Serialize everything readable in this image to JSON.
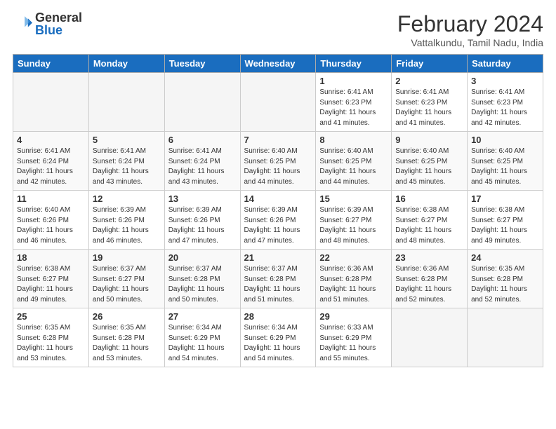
{
  "logo": {
    "general": "General",
    "blue": "Blue"
  },
  "title": "February 2024",
  "location": "Vattalkundu, Tamil Nadu, India",
  "days_of_week": [
    "Sunday",
    "Monday",
    "Tuesday",
    "Wednesday",
    "Thursday",
    "Friday",
    "Saturday"
  ],
  "weeks": [
    [
      {
        "day": "",
        "info": ""
      },
      {
        "day": "",
        "info": ""
      },
      {
        "day": "",
        "info": ""
      },
      {
        "day": "",
        "info": ""
      },
      {
        "day": "1",
        "info": "Sunrise: 6:41 AM\nSunset: 6:23 PM\nDaylight: 11 hours\nand 41 minutes."
      },
      {
        "day": "2",
        "info": "Sunrise: 6:41 AM\nSunset: 6:23 PM\nDaylight: 11 hours\nand 41 minutes."
      },
      {
        "day": "3",
        "info": "Sunrise: 6:41 AM\nSunset: 6:23 PM\nDaylight: 11 hours\nand 42 minutes."
      }
    ],
    [
      {
        "day": "4",
        "info": "Sunrise: 6:41 AM\nSunset: 6:24 PM\nDaylight: 11 hours\nand 42 minutes."
      },
      {
        "day": "5",
        "info": "Sunrise: 6:41 AM\nSunset: 6:24 PM\nDaylight: 11 hours\nand 43 minutes."
      },
      {
        "day": "6",
        "info": "Sunrise: 6:41 AM\nSunset: 6:24 PM\nDaylight: 11 hours\nand 43 minutes."
      },
      {
        "day": "7",
        "info": "Sunrise: 6:40 AM\nSunset: 6:25 PM\nDaylight: 11 hours\nand 44 minutes."
      },
      {
        "day": "8",
        "info": "Sunrise: 6:40 AM\nSunset: 6:25 PM\nDaylight: 11 hours\nand 44 minutes."
      },
      {
        "day": "9",
        "info": "Sunrise: 6:40 AM\nSunset: 6:25 PM\nDaylight: 11 hours\nand 45 minutes."
      },
      {
        "day": "10",
        "info": "Sunrise: 6:40 AM\nSunset: 6:25 PM\nDaylight: 11 hours\nand 45 minutes."
      }
    ],
    [
      {
        "day": "11",
        "info": "Sunrise: 6:40 AM\nSunset: 6:26 PM\nDaylight: 11 hours\nand 46 minutes."
      },
      {
        "day": "12",
        "info": "Sunrise: 6:39 AM\nSunset: 6:26 PM\nDaylight: 11 hours\nand 46 minutes."
      },
      {
        "day": "13",
        "info": "Sunrise: 6:39 AM\nSunset: 6:26 PM\nDaylight: 11 hours\nand 47 minutes."
      },
      {
        "day": "14",
        "info": "Sunrise: 6:39 AM\nSunset: 6:26 PM\nDaylight: 11 hours\nand 47 minutes."
      },
      {
        "day": "15",
        "info": "Sunrise: 6:39 AM\nSunset: 6:27 PM\nDaylight: 11 hours\nand 48 minutes."
      },
      {
        "day": "16",
        "info": "Sunrise: 6:38 AM\nSunset: 6:27 PM\nDaylight: 11 hours\nand 48 minutes."
      },
      {
        "day": "17",
        "info": "Sunrise: 6:38 AM\nSunset: 6:27 PM\nDaylight: 11 hours\nand 49 minutes."
      }
    ],
    [
      {
        "day": "18",
        "info": "Sunrise: 6:38 AM\nSunset: 6:27 PM\nDaylight: 11 hours\nand 49 minutes."
      },
      {
        "day": "19",
        "info": "Sunrise: 6:37 AM\nSunset: 6:27 PM\nDaylight: 11 hours\nand 50 minutes."
      },
      {
        "day": "20",
        "info": "Sunrise: 6:37 AM\nSunset: 6:28 PM\nDaylight: 11 hours\nand 50 minutes."
      },
      {
        "day": "21",
        "info": "Sunrise: 6:37 AM\nSunset: 6:28 PM\nDaylight: 11 hours\nand 51 minutes."
      },
      {
        "day": "22",
        "info": "Sunrise: 6:36 AM\nSunset: 6:28 PM\nDaylight: 11 hours\nand 51 minutes."
      },
      {
        "day": "23",
        "info": "Sunrise: 6:36 AM\nSunset: 6:28 PM\nDaylight: 11 hours\nand 52 minutes."
      },
      {
        "day": "24",
        "info": "Sunrise: 6:35 AM\nSunset: 6:28 PM\nDaylight: 11 hours\nand 52 minutes."
      }
    ],
    [
      {
        "day": "25",
        "info": "Sunrise: 6:35 AM\nSunset: 6:28 PM\nDaylight: 11 hours\nand 53 minutes."
      },
      {
        "day": "26",
        "info": "Sunrise: 6:35 AM\nSunset: 6:28 PM\nDaylight: 11 hours\nand 53 minutes."
      },
      {
        "day": "27",
        "info": "Sunrise: 6:34 AM\nSunset: 6:29 PM\nDaylight: 11 hours\nand 54 minutes."
      },
      {
        "day": "28",
        "info": "Sunrise: 6:34 AM\nSunset: 6:29 PM\nDaylight: 11 hours\nand 54 minutes."
      },
      {
        "day": "29",
        "info": "Sunrise: 6:33 AM\nSunset: 6:29 PM\nDaylight: 11 hours\nand 55 minutes."
      },
      {
        "day": "",
        "info": ""
      },
      {
        "day": "",
        "info": ""
      }
    ]
  ]
}
